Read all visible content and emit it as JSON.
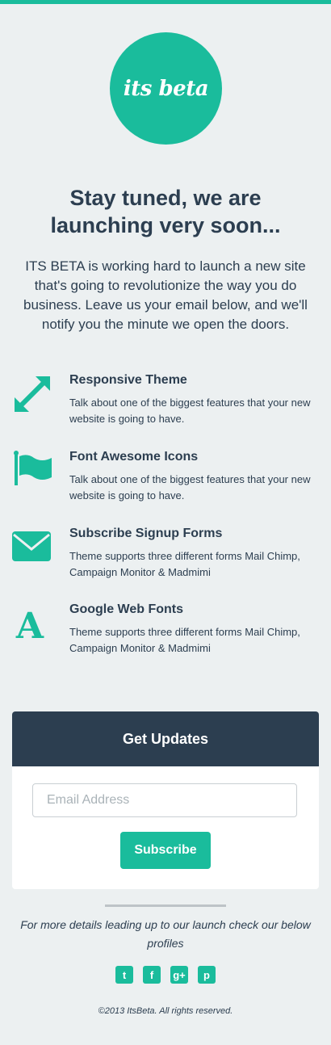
{
  "brand": {
    "logo_text": "its beta",
    "accent": "#1abc9c",
    "dark": "#2c3e50"
  },
  "hero": {
    "headline": "Stay tuned, we are launching very soon...",
    "lead": "ITS BETA is working hard to launch a new site that's going to revolutionize the way you do business. Leave us your email below, and we'll notify you the minute we open the doors."
  },
  "features": [
    {
      "icon": "resize-arrows-icon",
      "title": "Responsive Theme",
      "text": "Talk about one of the biggest features that your new website is going to have."
    },
    {
      "icon": "flag-icon",
      "title": "Font Awesome Icons",
      "text": "Talk about one of the biggest features that your new website is going to have."
    },
    {
      "icon": "envelope-icon",
      "title": "Subscribe Signup Forms",
      "text": "Theme supports three different forms Mail Chimp, Campaign Monitor & Madmimi"
    },
    {
      "icon": "font-icon",
      "title": "Google Web Fonts",
      "text": "Theme supports three different forms Mail Chimp, Campaign Monitor & Madmimi"
    }
  ],
  "signup": {
    "title": "Get Updates",
    "email_placeholder": "Email Address",
    "email_value": "",
    "button": "Subscribe"
  },
  "footer": {
    "details": "For more details leading up to our launch check our below profiles",
    "social": [
      {
        "icon": "twitter-icon",
        "glyph": "t"
      },
      {
        "icon": "facebook-icon",
        "glyph": "f"
      },
      {
        "icon": "google-plus-icon",
        "glyph": "g+"
      },
      {
        "icon": "pinterest-icon",
        "glyph": "p"
      }
    ],
    "copyright": "©2013 ItsBeta. All rights reserved."
  }
}
